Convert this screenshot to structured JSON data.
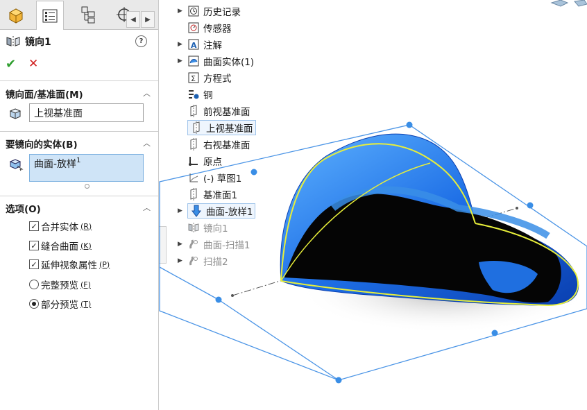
{
  "property_manager": {
    "title": "镜向1",
    "help": "?",
    "ok_glyph": "✔",
    "cancel_glyph": "✕",
    "group_mirror_face": {
      "title": "镜向面/基准面",
      "hotkey": "(M)",
      "value": "上视基准面"
    },
    "group_bodies": {
      "title": "要镜向的实体",
      "hotkey": "(B)",
      "value": "曲面-放样",
      "value_suffix": "1"
    },
    "group_options": {
      "title": "选项",
      "hotkey": "(O)",
      "checkboxes": [
        {
          "label": "合并实体",
          "hotkey": "(R)",
          "checked": true
        },
        {
          "label": "缝合曲面",
          "hotkey": "(K)",
          "checked": true
        },
        {
          "label": "延伸视象属性",
          "hotkey": "(P)",
          "checked": true
        }
      ],
      "radios": [
        {
          "label": "完整预览",
          "hotkey": "(F)",
          "selected": false
        },
        {
          "label": "部分预览",
          "hotkey": "(T)",
          "selected": true
        }
      ]
    }
  },
  "tabs": {
    "nav_left": "◀",
    "nav_right": "▶"
  },
  "feature_tree": [
    {
      "label": "历史记录",
      "icon": "history-icon",
      "expandable": true,
      "state": "normal"
    },
    {
      "label": "传感器",
      "icon": "sensor-icon",
      "expandable": false,
      "state": "normal"
    },
    {
      "label": "注解",
      "icon": "annotation-icon",
      "expandable": true,
      "state": "normal"
    },
    {
      "label": "曲面实体(1)",
      "icon": "surface-bodies-icon",
      "expandable": true,
      "state": "normal"
    },
    {
      "label": "方程式",
      "icon": "equation-icon",
      "expandable": false,
      "state": "normal"
    },
    {
      "label": "铜",
      "icon": "material-icon",
      "expandable": false,
      "state": "normal"
    },
    {
      "label": "前视基准面",
      "icon": "plane-icon",
      "expandable": false,
      "state": "normal"
    },
    {
      "label": "上视基准面",
      "icon": "plane-icon",
      "expandable": false,
      "state": "highlighted"
    },
    {
      "label": "右视基准面",
      "icon": "plane-icon",
      "expandable": false,
      "state": "normal"
    },
    {
      "label": "原点",
      "icon": "origin-icon",
      "expandable": false,
      "state": "normal"
    },
    {
      "label": "(-) 草图1",
      "icon": "sketch-icon",
      "expandable": false,
      "state": "normal"
    },
    {
      "label": "基准面1",
      "icon": "plane-icon",
      "expandable": false,
      "state": "normal"
    },
    {
      "label": "曲面-放样1",
      "icon": "loft-icon",
      "expandable": true,
      "state": "selected"
    },
    {
      "label": "镜向1",
      "icon": "mirror-icon",
      "expandable": false,
      "state": "grayed"
    },
    {
      "label": "曲面-扫描1",
      "icon": "sweep-surface-icon",
      "expandable": true,
      "state": "grayed"
    },
    {
      "label": "扫描2",
      "icon": "sweep-icon",
      "expandable": true,
      "state": "grayed"
    }
  ],
  "colors": {
    "accent": "#3a8ee6",
    "model_blue": "#1f6fe0",
    "selection_yellow": "#e8ef3a",
    "field_selected": "#cfe4f7"
  }
}
